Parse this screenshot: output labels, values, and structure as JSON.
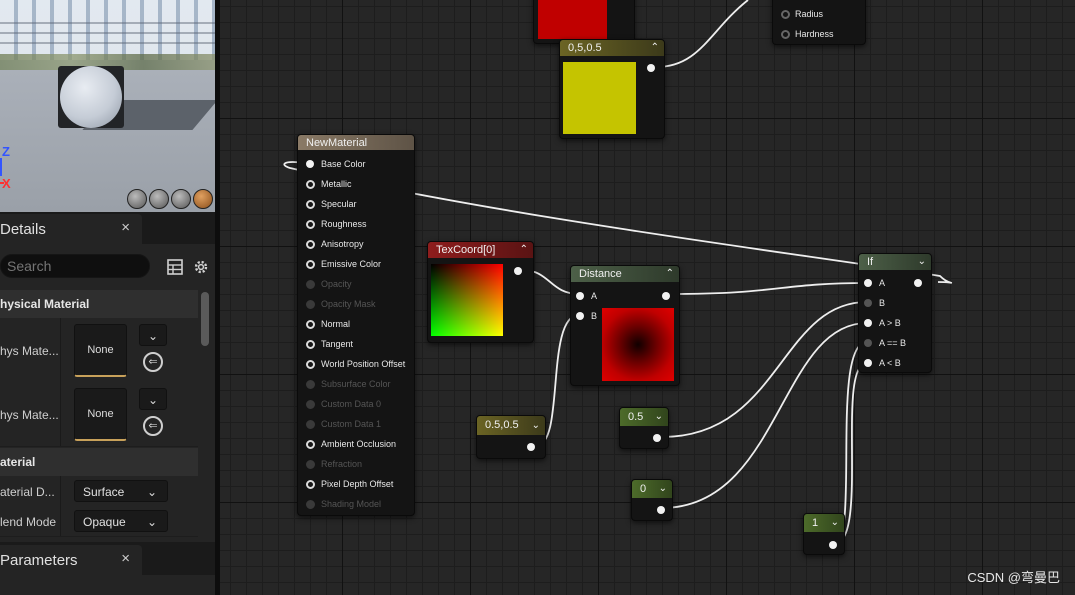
{
  "details": {
    "tab_label": "Details",
    "tab_close": "×",
    "search_placeholder": "Search",
    "section_physical": "hysical Material",
    "phys_row1_label": "hys Mate...",
    "phys_row2_label": "hys Mate...",
    "asset_none": "None",
    "section_material": "aterial",
    "domain_label": "aterial D...",
    "domain_value": "Surface",
    "blend_label": "lend Mode",
    "blend_value": "Opaque"
  },
  "parameters": {
    "tab_label": "Parameters",
    "tab_close": "×"
  },
  "viewport": {
    "axis_z": "Z",
    "axis_x": "X"
  },
  "graph": {
    "material_node": {
      "title": "NewMaterial",
      "pins": [
        {
          "label": "Base Color",
          "enabled": true,
          "connected": true
        },
        {
          "label": "Metallic",
          "enabled": true,
          "connected": false
        },
        {
          "label": "Specular",
          "enabled": true,
          "connected": false
        },
        {
          "label": "Roughness",
          "enabled": true,
          "connected": false
        },
        {
          "label": "Anisotropy",
          "enabled": true,
          "connected": false
        },
        {
          "label": "Emissive Color",
          "enabled": true,
          "connected": false
        },
        {
          "label": "Opacity",
          "enabled": false,
          "connected": false
        },
        {
          "label": "Opacity Mask",
          "enabled": false,
          "connected": false
        },
        {
          "label": "Normal",
          "enabled": true,
          "connected": false
        },
        {
          "label": "Tangent",
          "enabled": true,
          "connected": false
        },
        {
          "label": "World Position Offset",
          "enabled": true,
          "connected": false
        },
        {
          "label": "Subsurface Color",
          "enabled": false,
          "connected": false
        },
        {
          "label": "Custom Data 0",
          "enabled": false,
          "connected": false
        },
        {
          "label": "Custom Data 1",
          "enabled": false,
          "connected": false
        },
        {
          "label": "Ambient Occlusion",
          "enabled": true,
          "connected": false
        },
        {
          "label": "Refraction",
          "enabled": false,
          "connected": false
        },
        {
          "label": "Pixel Depth Offset",
          "enabled": true,
          "connected": false
        },
        {
          "label": "Shading Model",
          "enabled": false,
          "connected": false
        }
      ]
    },
    "texcoord_title": "TexCoord[0]",
    "distance_title": "Distance",
    "distance_pin_a": "A",
    "distance_pin_b": "B",
    "const2_title": "0,5,0.5",
    "const2_bottom_title": "0.5,0.5",
    "const_05": "0.5",
    "const_0": "0",
    "const_1": "1",
    "if_title": "If",
    "if_pins": [
      "A",
      "B",
      "A > B",
      "A == B",
      "A < B"
    ],
    "partial_node_pins": [
      "Radius",
      "Hardness"
    ]
  },
  "watermark": "CSDN @弯曼巴",
  "colors": {
    "yellow_swatch": "#c5c400",
    "red_swatch": "#c00000",
    "const_green": "#4d6b2a",
    "const_olive": "#6b6424",
    "texcoord_red": "#8e1d1d",
    "math_green": "#4d6048"
  }
}
